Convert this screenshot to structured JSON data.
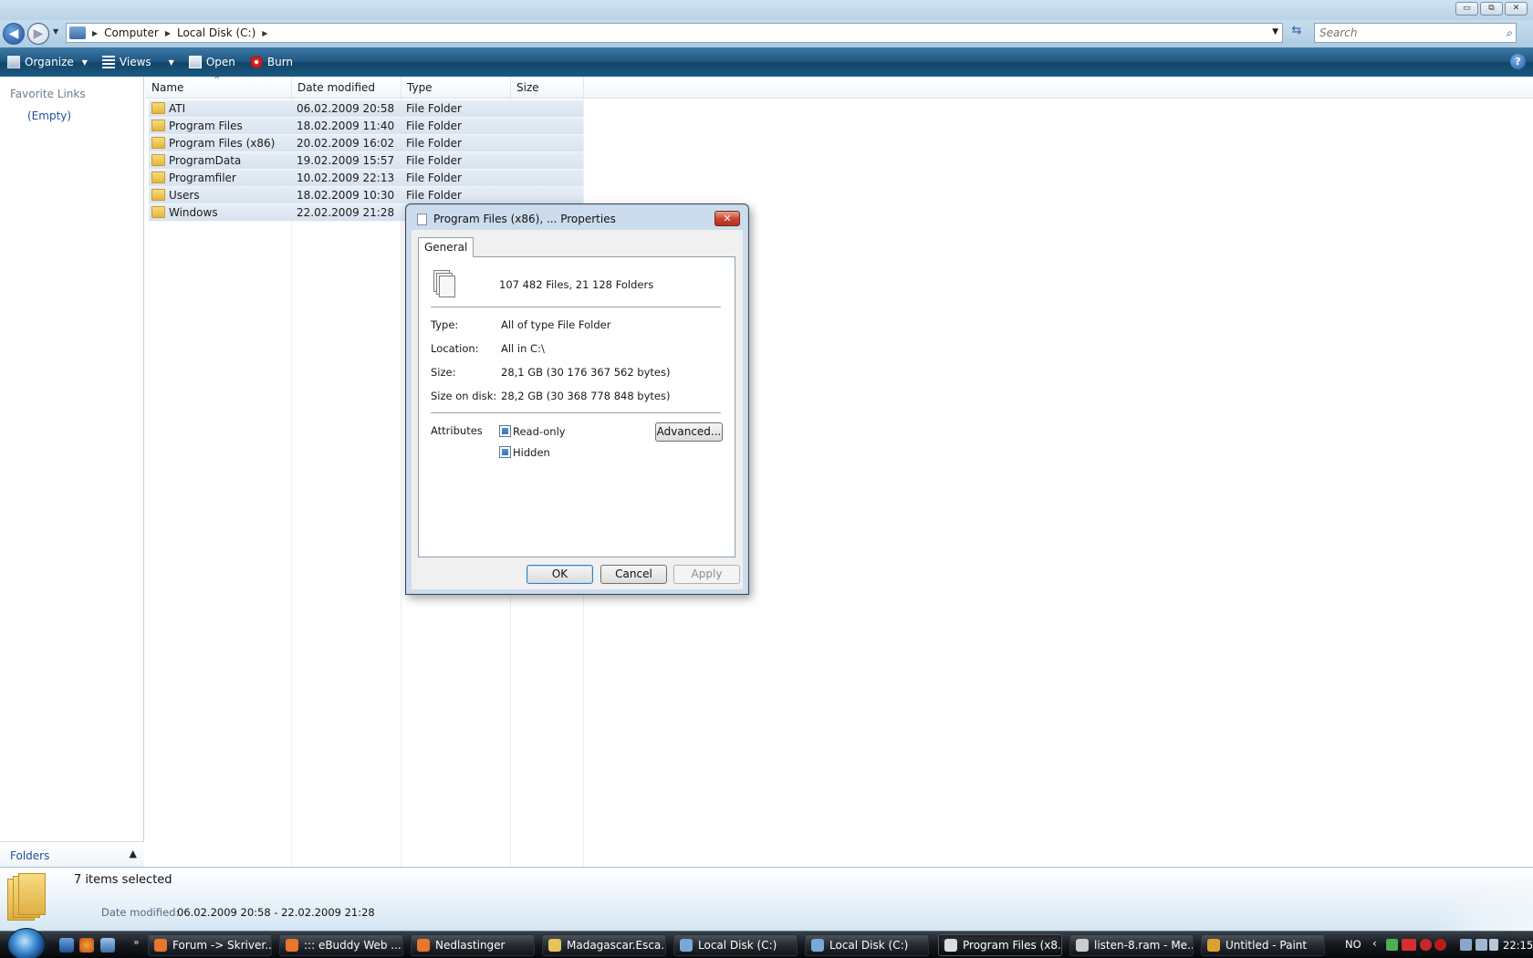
{
  "window": {
    "controls": {
      "minimize": "▭",
      "restore": "⧉",
      "close": "✕"
    }
  },
  "address": {
    "crumbs": [
      "Computer",
      "Local Disk (C:)"
    ],
    "search_placeholder": "Search"
  },
  "toolbar": {
    "organize": "Organize",
    "views": "Views",
    "open": "Open",
    "burn": "Burn",
    "help": "?"
  },
  "navpane": {
    "heading": "Favorite Links",
    "empty": "(Empty)",
    "folders_label": "Folders"
  },
  "filelist": {
    "columns": [
      "Name",
      "Date modified",
      "Type",
      "Size"
    ],
    "rows": [
      {
        "name": "ATI",
        "date": "06.02.2009 20:58",
        "type": "File Folder",
        "size": ""
      },
      {
        "name": "Program Files",
        "date": "18.02.2009 11:40",
        "type": "File Folder",
        "size": ""
      },
      {
        "name": "Program Files (x86)",
        "date": "20.02.2009 16:02",
        "type": "File Folder",
        "size": ""
      },
      {
        "name": "ProgramData",
        "date": "19.02.2009 15:57",
        "type": "File Folder",
        "size": ""
      },
      {
        "name": "Programfiler",
        "date": "10.02.2009 22:13",
        "type": "File Folder",
        "size": ""
      },
      {
        "name": "Users",
        "date": "18.02.2009 10:30",
        "type": "File Folder",
        "size": ""
      },
      {
        "name": "Windows",
        "date": "22.02.2009 21:28",
        "type": "",
        "size": ""
      }
    ]
  },
  "dialog": {
    "title": "Program Files (x86), ... Properties",
    "close": "✕",
    "tab": "General",
    "summary": "107 482 Files, 21 128 Folders",
    "type_label": "Type:",
    "type_value": "All of type File Folder",
    "location_label": "Location:",
    "location_value": "All in C:\\",
    "size_label": "Size:",
    "size_value": "28,1 GB (30 176 367 562 bytes)",
    "size_on_disk_label": "Size on disk:",
    "size_on_disk_value": "28,2 GB (30 368 778 848 bytes)",
    "attributes_label": "Attributes",
    "readonly_label": "Read-only",
    "hidden_label": "Hidden",
    "advanced_button": "Advanced...",
    "ok_button": "OK",
    "cancel_button": "Cancel",
    "apply_button": "Apply"
  },
  "details": {
    "title": "7 items selected",
    "date_label": "Date modified:",
    "date_value": "06.02.2009 20:58 - 22.02.2009 21:28"
  },
  "taskbar": {
    "chevron": "»",
    "buttons": [
      {
        "label": "Forum -> Skriver...",
        "color": "#e8762b"
      },
      {
        "label": "::: eBuddy Web ...",
        "color": "#e8762b"
      },
      {
        "label": "Nedlastinger",
        "color": "#e8762b"
      },
      {
        "label": "Madagascar.Esca...",
        "color": "#e6c35a"
      },
      {
        "label": "Local Disk (C:)",
        "color": "#7aa7d6"
      },
      {
        "label": "Local Disk (C:)",
        "color": "#7aa7d6"
      },
      {
        "label": "Program Files (x8...",
        "color": "#dddddd"
      },
      {
        "label": "listen-8.ram - Me...",
        "color": "#cccccc"
      },
      {
        "label": "Untitled - Paint",
        "color": "#e0a030"
      }
    ],
    "tray_lang": "NO",
    "tray_chevron": "‹",
    "clock": "22:15"
  }
}
